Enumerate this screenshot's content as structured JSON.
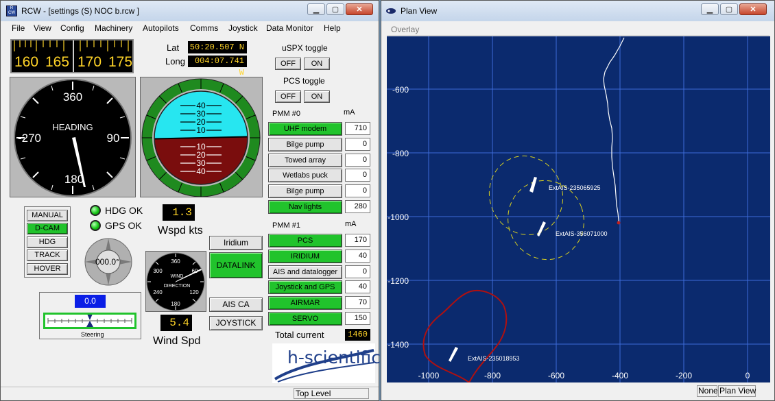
{
  "rcw_window": {
    "title": "RCW - [settings (S) NOC b.rcw ]",
    "menu": [
      "File",
      "View",
      "Config",
      "Machinery",
      "Autopilots",
      "Comms",
      "Joystick",
      "Data Monitor",
      "Help"
    ],
    "compass_tape": {
      "ticks": [
        "160",
        "165",
        "170",
        "175"
      ]
    },
    "lat_label": "Lat",
    "lat_value": "50:20.507 N",
    "long_label": "Long",
    "long_value": "004:07.741 W",
    "uspx_label": "uSPX toggle",
    "pcs_label": "PCS toggle",
    "off_label": "OFF",
    "on_label": "ON",
    "heading_dial": {
      "label": "HEADING",
      "n": "360",
      "e": "90",
      "s": "180",
      "w": "-270"
    },
    "attitude": {
      "pitch_labels_up": [
        "40",
        "30",
        "20",
        "10"
      ],
      "pitch_labels_down": [
        "10",
        "20",
        "30",
        "40"
      ]
    },
    "pmm0": {
      "title": "PMM #0",
      "unit": "mA",
      "items": [
        {
          "label": "UHF modem",
          "value": "710",
          "on": true
        },
        {
          "label": "Bilge pump",
          "value": "0",
          "on": false
        },
        {
          "label": "Towed array",
          "value": "0",
          "on": false
        },
        {
          "label": "Wetlabs puck",
          "value": "0",
          "on": false
        },
        {
          "label": "Bilge pump",
          "value": "0",
          "on": false
        },
        {
          "label": "Nav lights",
          "value": "280",
          "on": true
        }
      ]
    },
    "pmm1": {
      "title": "PMM #1",
      "unit": "mA",
      "items": [
        {
          "label": "PCS",
          "value": "170",
          "on": true
        },
        {
          "label": "IRIDIUM",
          "value": "40",
          "on": true
        },
        {
          "label": "AIS and datalogger",
          "value": "0",
          "on": false
        },
        {
          "label": "Joystick and GPS",
          "value": "40",
          "on": true
        },
        {
          "label": "AIRMAR",
          "value": "70",
          "on": true
        },
        {
          "label": "SERVO",
          "value": "150",
          "on": true
        }
      ]
    },
    "total_current_label": "Total current",
    "total_current_value": "1460",
    "modes": [
      "MANUAL",
      "D-CAM",
      "HDG",
      "TRACK",
      "HOVER"
    ],
    "hdg_ok": "HDG OK",
    "gps_ok": "GPS OK",
    "wspd_value": "1.3",
    "wspd_label": "Wspd kts",
    "azimuth_value": "000.0°",
    "iridium_btn": "Iridium",
    "datalink_btn": "DATALINK",
    "aisca_btn": "AIS CA",
    "joystick_btn": "JOYSTICK",
    "wind_dial": {
      "n": "360",
      "ne": "60",
      "e": "120",
      "s": "180",
      "sw": "240",
      "nw": "300",
      "label1": "WIND",
      "label2": "DIRECTION"
    },
    "wind_spd_value": "5.4",
    "wind_spd_label": "Wind Spd",
    "steering_value": "0.0",
    "steering_label": "Steering",
    "logo_text": "h-scientific",
    "status_text": "Top Level"
  },
  "plan_window": {
    "title": "Plan View",
    "toolbar_label": "Overlay",
    "y_ticks": [
      "-600",
      "-800",
      "-1000",
      "-1200",
      "-1400"
    ],
    "x_ticks": [
      "-1000",
      "-800",
      "-600",
      "-400",
      "-200",
      "0"
    ],
    "ais_labels": [
      "ExtAIS-235065925",
      "ExtAIS-356071000",
      "ExtAIS-235018953"
    ],
    "status_none": "None",
    "status_view": "Plan View"
  },
  "colors": {
    "accent_green": "#21c32c",
    "plot_bg": "#0b2a6e",
    "sky": "#27e6f0",
    "ground": "#7a0d0d"
  }
}
